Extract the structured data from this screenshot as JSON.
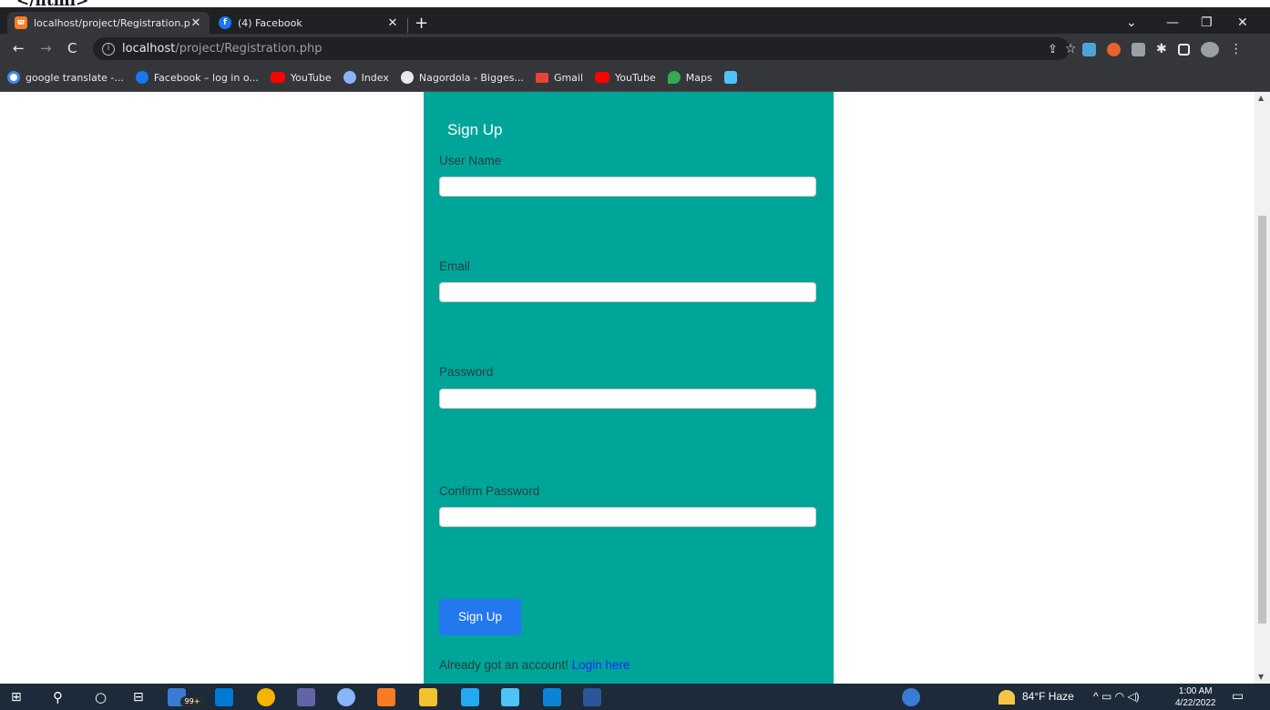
{
  "stray_text": "</html>",
  "browser": {
    "tabs": [
      {
        "title": "localhost/project/Registration.ph",
        "favicon": "xampp-icon",
        "active": true
      },
      {
        "title": "(4) Facebook",
        "favicon": "facebook-icon",
        "active": false
      }
    ],
    "new_tab": "+",
    "address": {
      "host": "localhost",
      "path": "/project/Registration.php"
    },
    "bookmarks": [
      {
        "label": "google translate -...",
        "icon": "google-icon",
        "color": "#4285f4"
      },
      {
        "label": "Facebook – log in o...",
        "icon": "facebook-icon",
        "color": "#1877f2"
      },
      {
        "label": "YouTube",
        "icon": "youtube-icon",
        "color": "#ff0000"
      },
      {
        "label": "Index",
        "icon": "index-icon",
        "color": "#8ab4f8"
      },
      {
        "label": "Nagordola - Bigges...",
        "icon": "globe-icon",
        "color": "#e8eaed"
      },
      {
        "label": "Gmail",
        "icon": "gmail-icon",
        "color": "#ea4335"
      },
      {
        "label": "YouTube",
        "icon": "youtube-icon",
        "color": "#ff0000"
      },
      {
        "label": "Maps",
        "icon": "maps-icon",
        "color": "#34a853"
      }
    ]
  },
  "form": {
    "heading": "Sign Up",
    "fields": [
      {
        "label": "User Name",
        "value": ""
      },
      {
        "label": "Email",
        "value": ""
      },
      {
        "label": "Password",
        "value": ""
      },
      {
        "label": "Confirm Password",
        "value": ""
      }
    ],
    "submit_label": "Sign Up",
    "already_text": "Already got an account!",
    "login_link": "Login here",
    "card_color": "#00a59a",
    "button_color": "#2377ef"
  },
  "taskbar": {
    "weather": "84°F  Haze",
    "time": "1:00 AM",
    "date": "4/22/2022",
    "mail_badge": "99+"
  }
}
